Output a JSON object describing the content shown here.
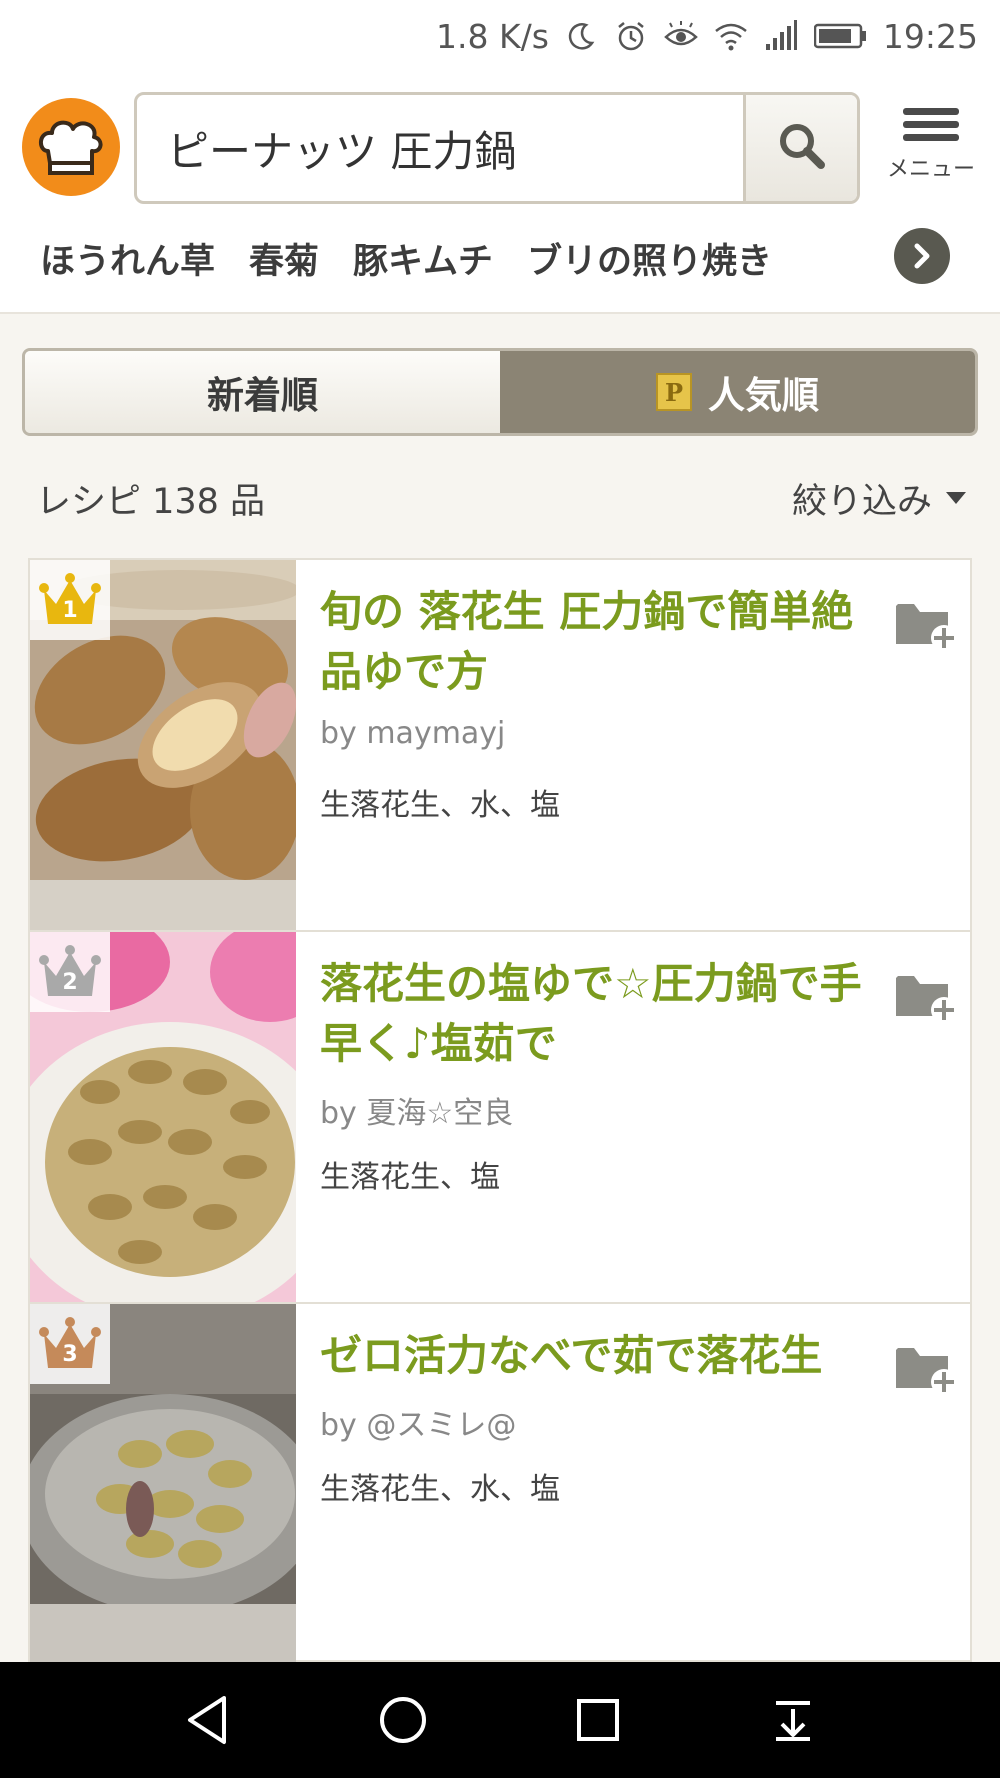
{
  "status_bar": {
    "speed": "1.8 K/s",
    "time": "19:25",
    "icons": [
      "moon-icon",
      "alarm-icon",
      "eye-icon",
      "wifi-icon",
      "signal-icon",
      "battery-icon"
    ]
  },
  "header": {
    "logo_icon": "chef-hat-icon",
    "search": {
      "value": "ピーナッツ 圧力鍋",
      "icon": "search-icon"
    },
    "menu": {
      "icon": "hamburger-icon",
      "label": "メニュー"
    },
    "keywords": [
      "ほうれん草",
      "春菊",
      "豚キムチ",
      "ブリの照り焼き"
    ],
    "keywords_next_icon": "chevron-right-icon"
  },
  "sort_tabs": {
    "newest": "新着順",
    "popular": "人気順",
    "popular_badge": "P",
    "selected": "popular"
  },
  "results": {
    "count_label": "レシピ 138 品",
    "filter_label": "絞り込み"
  },
  "recipes": [
    {
      "rank": "1",
      "rank_color": "#e8b70f",
      "title": "旬の 落花生 圧力鍋で簡単絶品ゆで方",
      "author": "by maymayj",
      "ingredients": "生落花生、水、塩"
    },
    {
      "rank": "2",
      "rank_color": "#a9a9a9",
      "title": "落花生の塩ゆで☆圧力鍋で手早く♪塩茹で",
      "author": "by 夏海☆空良",
      "ingredients": "生落花生、塩"
    },
    {
      "rank": "3",
      "rank_color": "#c58a5a",
      "title": "ゼロ活力なべで茹で落花生",
      "author": "by @スミレ@",
      "ingredients": "生落花生、水、塩"
    }
  ],
  "colors": {
    "brand_orange": "#f28c1a",
    "title_green": "#7b9b1e",
    "tab_active": "#8b8474"
  },
  "nav_bar": [
    "back-icon",
    "home-icon",
    "recents-icon",
    "notification-pull-icon"
  ]
}
